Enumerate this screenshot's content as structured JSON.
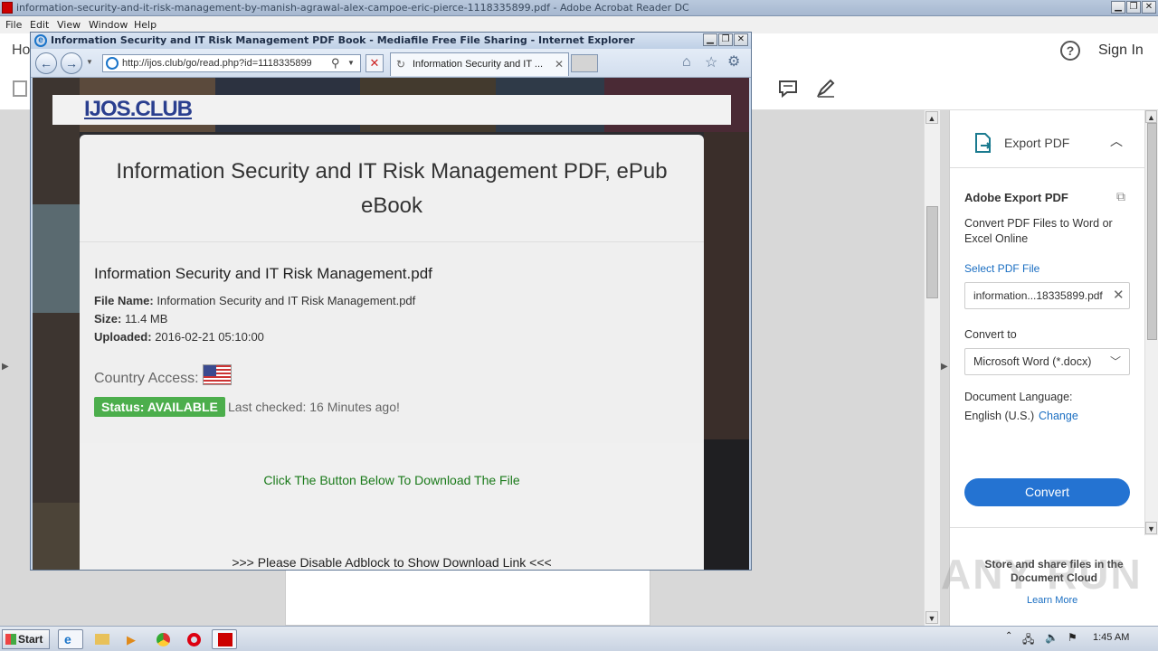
{
  "acrobat": {
    "window_title": "information-security-and-it-risk-management-by-manish-agrawal-alex-campoe-eric-pierce-1118335899.pdf - Adobe Acrobat Reader DC",
    "menu": [
      "File",
      "Edit",
      "View",
      "Window",
      "Help"
    ],
    "home_tab": "Ho",
    "sign_in": "Sign In",
    "help_icon": "?"
  },
  "right_panel": {
    "section_title": "Export PDF",
    "product": "Adobe Export PDF",
    "description": "Convert PDF Files to Word or Excel Online",
    "select_label": "Select PDF File",
    "selected_file": "information...18335899.pdf",
    "convert_to_label": "Convert to",
    "convert_to_value": "Microsoft Word (*.docx)",
    "language_label": "Document Language:",
    "language_value": "English (U.S.)",
    "change_link": "Change",
    "convert_button": "Convert",
    "store_text": "Store and share files in the Document Cloud",
    "learn_more": "Learn More"
  },
  "ie": {
    "window_title": "Information Security and IT Risk Management PDF Book - Mediafile Free File Sharing - Internet Explorer",
    "url": "http://ijos.club/go/read.php?id=1118335899",
    "tab_label": "Information Security and IT ..."
  },
  "site": {
    "logo": "IJOS.CLUB",
    "title": "Information Security and IT Risk Management PDF, ePub eBook",
    "file_heading": "Information Security and IT Risk Management.pdf",
    "file_name_label": "File Name:",
    "file_name_value": "Information Security and IT Risk Management.pdf",
    "size_label": "Size:",
    "size_value": "11.4 MB",
    "uploaded_label": "Uploaded:",
    "uploaded_value": "2016-02-21 05:10:00",
    "country_access": "Country Access:",
    "status": "Status: AVAILABLE",
    "last_checked": "Last checked: 16 Minutes ago!",
    "click_msg": "Click The Button Below To Download The File",
    "adblock_msg": ">>> Please Disable Adblock to Show Download Link <<<"
  },
  "taskbar": {
    "start": "Start",
    "clock": "1:45 AM"
  },
  "watermark": "ANY RUN"
}
